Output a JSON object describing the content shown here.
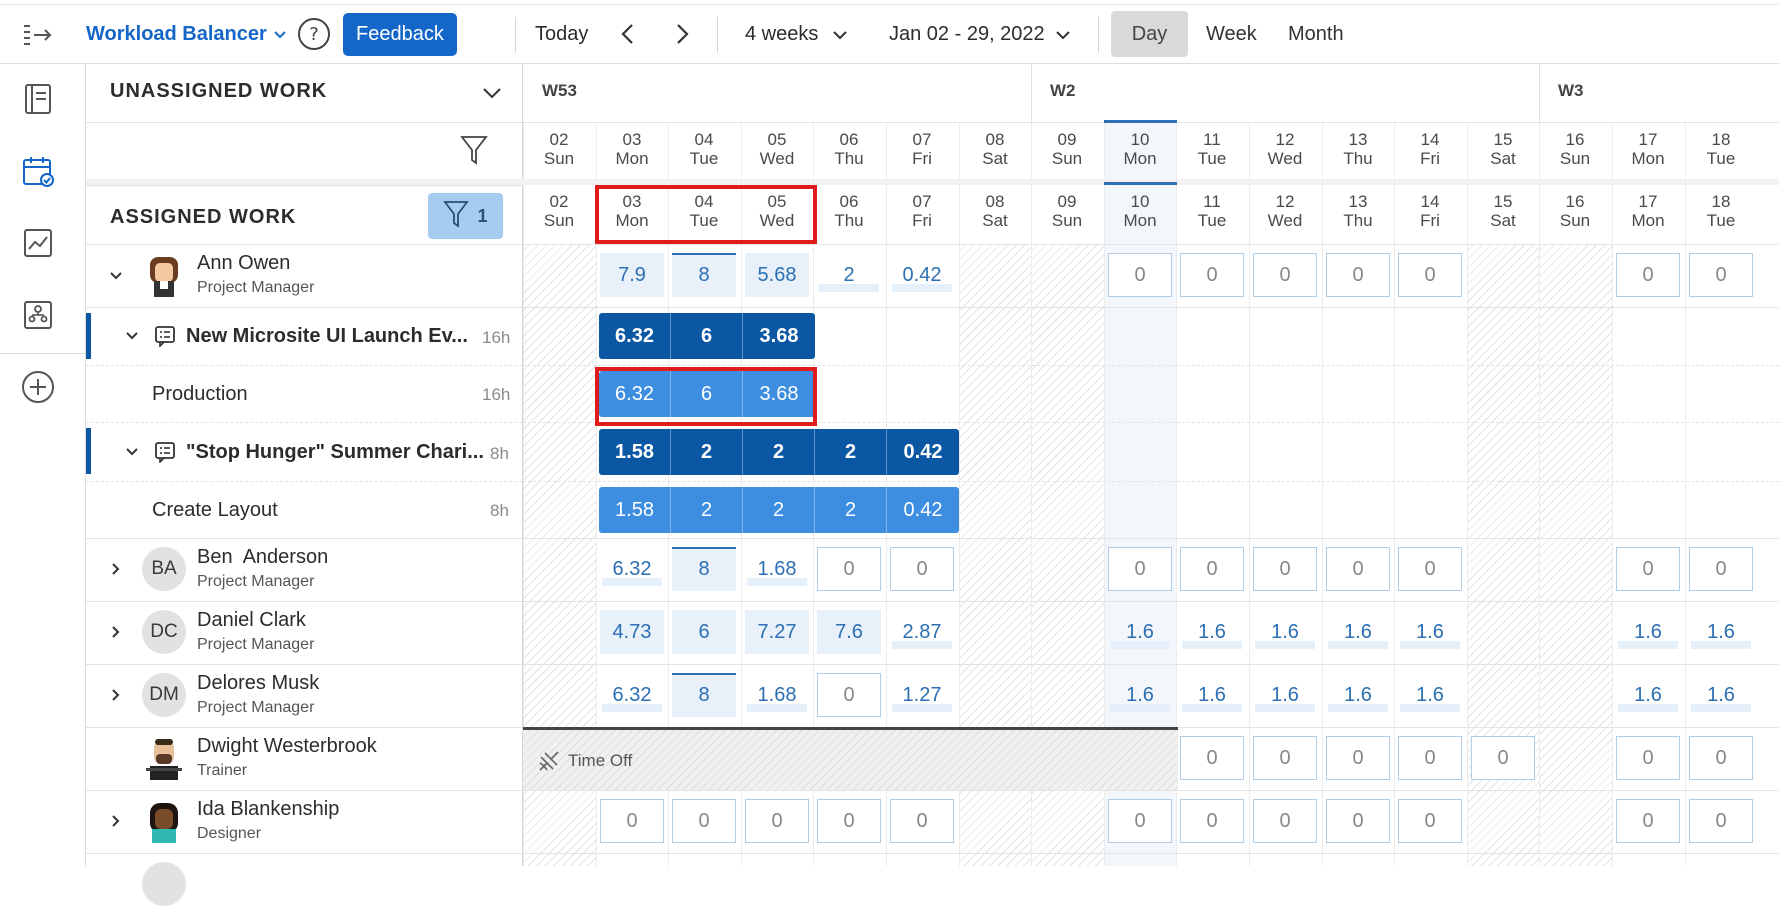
{
  "toolbar": {
    "app_title": "Workload Balancer",
    "feedback_label": "Feedback",
    "today_label": "Today",
    "range_select": "4 weeks",
    "date_range": "Jan 02 - 29, 2022",
    "view_day": "Day",
    "view_week": "Week",
    "view_month": "Month"
  },
  "unassigned": {
    "title": "UNASSIGNED WORK"
  },
  "assigned": {
    "title": "ASSIGNED WORK",
    "filter_count": "1"
  },
  "timeline": {
    "weeks": [
      "W53",
      "W2",
      "W3"
    ],
    "days": [
      {
        "num": "02",
        "dow": "Sun"
      },
      {
        "num": "03",
        "dow": "Mon"
      },
      {
        "num": "04",
        "dow": "Tue"
      },
      {
        "num": "05",
        "dow": "Wed"
      },
      {
        "num": "06",
        "dow": "Thu"
      },
      {
        "num": "07",
        "dow": "Fri"
      },
      {
        "num": "08",
        "dow": "Sat"
      },
      {
        "num": "09",
        "dow": "Sun"
      },
      {
        "num": "10",
        "dow": "Mon"
      },
      {
        "num": "11",
        "dow": "Tue"
      },
      {
        "num": "12",
        "dow": "Wed"
      },
      {
        "num": "13",
        "dow": "Thu"
      },
      {
        "num": "14",
        "dow": "Fri"
      },
      {
        "num": "15",
        "dow": "Sat"
      },
      {
        "num": "16",
        "dow": "Sun"
      },
      {
        "num": "17",
        "dow": "Mon"
      },
      {
        "num": "18",
        "dow": "Tue"
      }
    ]
  },
  "rows": [
    {
      "name": "Ann Owen",
      "role": "Project Manager",
      "values": [
        "7.9",
        "8",
        "5.68",
        "2",
        "0.42",
        "0",
        "0",
        "0",
        "0",
        "0",
        "0",
        "0"
      ]
    },
    {
      "project": "New Microsite UI Launch Ev...",
      "hours": "16h",
      "values": [
        "6.32",
        "6",
        "3.68"
      ]
    },
    {
      "task": "Production",
      "hours": "16h",
      "values": [
        "6.32",
        "6",
        "3.68"
      ]
    },
    {
      "project": "\"Stop Hunger\" Summer Chari...",
      "hours": "8h",
      "values": [
        "1.58",
        "2",
        "2",
        "2",
        "0.42"
      ]
    },
    {
      "task": "Create Layout",
      "hours": "8h",
      "values": [
        "1.58",
        "2",
        "2",
        "2",
        "0.42"
      ]
    },
    {
      "name": "Ben  Anderson",
      "role": "Project Manager",
      "initials": "BA",
      "values": [
        "6.32",
        "8",
        "1.68",
        "0",
        "0",
        "0",
        "0",
        "0",
        "0",
        "0",
        "0",
        "0"
      ]
    },
    {
      "name": "Daniel Clark",
      "role": "Project Manager",
      "initials": "DC",
      "values": [
        "4.73",
        "6",
        "7.27",
        "7.6",
        "2.87",
        "1.6",
        "1.6",
        "1.6",
        "1.6",
        "1.6",
        "1.6",
        "1.6"
      ]
    },
    {
      "name": "Delores Musk",
      "role": "Project Manager",
      "initials": "DM",
      "values": [
        "6.32",
        "8",
        "1.68",
        "0",
        "1.27",
        "1.6",
        "1.6",
        "1.6",
        "1.6",
        "1.6",
        "1.6",
        "1.6"
      ]
    },
    {
      "name": "Dwight Westerbrook",
      "role": "Trainer",
      "time_off": "Time Off",
      "values": [
        "0",
        "0",
        "0",
        "0",
        "0",
        "0",
        "0"
      ]
    },
    {
      "name": "Ida Blankenship",
      "role": "Designer",
      "values": [
        "0",
        "0",
        "0",
        "0",
        "0",
        "0",
        "0",
        "0",
        "0",
        "0",
        "0",
        "0"
      ]
    }
  ],
  "colors": {
    "brand": "#0b57a4",
    "accent": "#3d8ee0",
    "highlight": "#e01b1b"
  }
}
